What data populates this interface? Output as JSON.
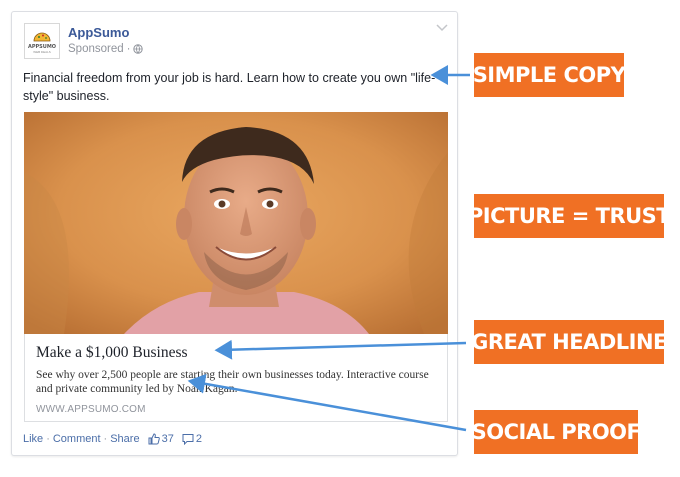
{
  "post": {
    "page_name": "AppSumo",
    "logo_text": "APPSUMO",
    "logo_subtext": "WEB DEALS",
    "sponsored": "Sponsored",
    "separator": "·",
    "text": "Financial freedom from your job is hard. Learn how to create you own \"life-style\" business.",
    "link": {
      "headline": "Make a $1,000 Business",
      "description": "See why over 2,500 people are starting their own businesses today. Interactive course and private community led by Noah Kagan.",
      "url": "WWW.APPSUMO.COM"
    },
    "actions": {
      "like": "Like",
      "comment": "Comment",
      "share": "Share",
      "separator": "·",
      "like_count": "37",
      "comment_count": "2"
    }
  },
  "annotations": {
    "simple_copy": "SIMPLE COPY",
    "picture_trust": "PICTURE = TRUST",
    "great_headline": "GREAT HEADLINE",
    "social_proof": "SOCIAL PROOF"
  },
  "colors": {
    "facebook_blue": "#3b5998",
    "annotation_orange": "#f07024",
    "arrow_blue": "#4a90d9"
  },
  "icons": {
    "globe": "globe-icon",
    "chevron": "chevron-down-icon",
    "thumbs_up": "thumbs-up-icon",
    "comment": "comment-bubble-icon",
    "logo": "appsumo-taco-logo"
  }
}
